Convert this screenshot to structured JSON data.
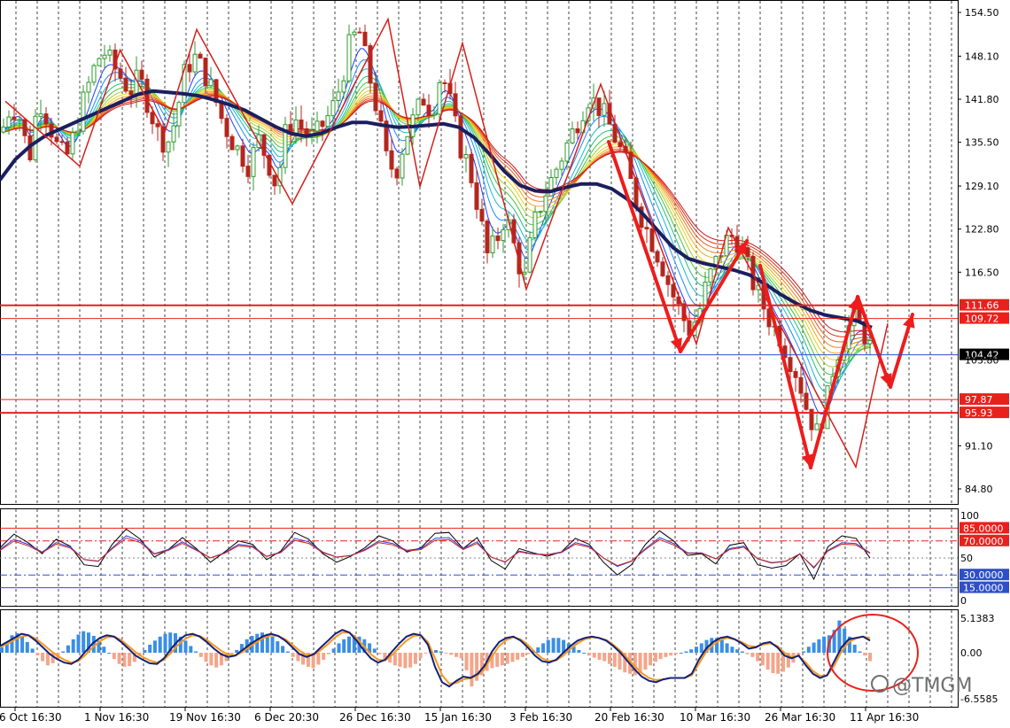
{
  "chart_data": [
    {
      "type": "candlestick",
      "yaxis": {
        "ticks": [
          154.5,
          148.1,
          141.8,
          135.5,
          129.1,
          122.8,
          116.5,
          91.1,
          84.8
        ],
        "ylim": [
          81.6,
          157.5
        ]
      },
      "x_labels": [
        "6 Oct 16:30",
        "1 Nov 16:30",
        "19 Nov 16:30",
        "6 Dec 20:30",
        "26 Dec 16:30",
        "15 Jan 16:30",
        "3 Feb 16:30",
        "20 Feb 16:30",
        "10 Mar 16:30",
        "26 Mar 16:30",
        "11 Apr 16:30"
      ],
      "close_series": [
        {
          "name": "p1",
          "values": [
            137,
            141,
            139,
            133,
            142,
            139,
            135,
            133,
            137,
            142,
            146,
            149,
            147,
            145,
            143,
            145,
            141,
            137,
            135,
            139,
            146,
            148,
            146,
            143,
            139,
            136,
            134,
            132,
            136,
            133,
            129,
            137,
            139,
            137,
            136,
            138,
            140,
            144,
            150,
            152,
            146,
            140,
            133,
            131,
            136,
            139,
            142,
            140,
            146,
            141,
            135,
            132,
            126,
            119,
            121,
            125,
            120,
            115,
            123,
            127,
            130,
            133,
            136,
            139,
            142,
            141,
            139,
            136,
            133,
            128,
            124,
            121,
            118,
            114,
            111,
            108,
            110,
            115,
            118,
            121,
            122,
            119,
            115,
            112,
            109,
            107,
            104,
            101,
            96,
            93,
            97,
            104,
            107,
            110,
            108,
            105
          ]
        }
      ],
      "ma_thick": [
        130,
        133,
        135,
        136.5,
        137.5,
        138.5,
        139.5,
        140.5,
        141.5,
        142.5,
        143,
        142.8,
        142.6,
        142.3,
        141.7,
        141.0,
        140.2,
        139.0,
        137.8,
        136.8,
        136.4,
        136.8,
        137.7,
        138.4,
        138.4,
        138.0,
        137.7,
        137.8,
        138.0,
        138.2,
        137.7,
        136.2,
        133.8,
        131.2,
        129.2,
        128.4,
        128.3,
        128.9,
        129.4,
        129.4,
        128.7,
        127.2,
        125.1,
        122.6,
        120.1,
        118.5,
        117.8,
        117.3,
        116.8,
        116.1,
        114.8,
        113.3,
        112.0,
        110.9,
        110.2,
        109.8,
        109.4,
        108.4
      ],
      "zigzag_thin": [
        [
          141.5,
          -0.5
        ],
        [
          132,
          3
        ],
        [
          149,
          4.9
        ],
        [
          137,
          7
        ],
        [
          152,
          8.5
        ],
        [
          126.5,
          13
        ],
        [
          153.5,
          17.5
        ],
        [
          129,
          19
        ],
        [
          150,
          21
        ],
        [
          114,
          24
        ],
        [
          144,
          27.5
        ],
        [
          106,
          32
        ],
        [
          123,
          33.5
        ],
        [
          88,
          39.5
        ],
        [
          109,
          41
        ]
      ],
      "forecast": [
        [
          111,
          40.5
        ],
        [
          101,
          41.7
        ],
        [
          107,
          42.5
        ]
      ],
      "hlines": [
        {
          "label": "111.66",
          "value": 111.66,
          "color": "#e8211c",
          "width": 2
        },
        {
          "label": "109.72",
          "value": 109.72,
          "color": "#e8211c",
          "width": 1
        },
        {
          "label": "104.42",
          "value": 104.42,
          "color": "#2f4fc9",
          "width": 1
        },
        {
          "label": "97.87",
          "value": 97.87,
          "color": "#e8211c",
          "width": 1
        },
        {
          "label": "95.93",
          "value": 95.93,
          "color": "#e8211c",
          "width": 2
        }
      ],
      "current_price": "104.42",
      "hidden_tick": "103.80"
    },
    {
      "type": "line",
      "yaxis": {
        "ticks": [
          "100",
          "50",
          "0"
        ],
        "ylim": [
          0,
          100
        ]
      },
      "levels": [
        {
          "label": "85.0000",
          "value": 85,
          "color": "#e8211c",
          "style": "solid"
        },
        {
          "label": "70.0000",
          "value": 70,
          "color": "#e8211c",
          "style": "dashdot"
        },
        {
          "label": "30.0000",
          "value": 30,
          "color": "#2f4fc9",
          "style": "dashdot"
        },
        {
          "label": "15.0000",
          "value": 15,
          "color": "#2f4fc9",
          "style": "solid"
        }
      ],
      "series": [
        {
          "values": [
            62,
            78,
            68,
            55,
            72,
            64,
            42,
            40,
            66,
            84,
            72,
            51,
            60,
            74,
            61,
            45,
            57,
            70,
            66,
            48,
            58,
            80,
            72,
            55,
            45,
            52,
            62,
            76,
            70,
            57,
            62,
            79,
            80,
            61,
            74,
            47,
            37,
            61,
            56,
            52,
            57,
            73,
            66,
            45,
            30,
            42,
            66,
            82,
            70,
            53,
            55,
            43,
            65,
            68,
            42,
            38,
            41,
            55,
            25,
            63,
            76,
            73,
            50
          ]
        },
        {
          "values": [
            60,
            72,
            66,
            57,
            68,
            63,
            48,
            46,
            62,
            76,
            70,
            55,
            60,
            69,
            60,
            50,
            56,
            66,
            64,
            52,
            57,
            73,
            69,
            57,
            51,
            53,
            60,
            70,
            67,
            59,
            61,
            73,
            74,
            61,
            69,
            51,
            45,
            58,
            55,
            54,
            57,
            68,
            64,
            50,
            40,
            46,
            61,
            74,
            67,
            56,
            56,
            49,
            61,
            64,
            49,
            44,
            46,
            55,
            38,
            59,
            68,
            67,
            56
          ]
        }
      ]
    },
    {
      "type": "bar",
      "yaxis": {
        "ticks": [
          "5.1383",
          "0.00",
          "-6.5585"
        ],
        "ylim": [
          -6.5585,
          5.1383
        ]
      },
      "histogram": [
        0.8,
        1.5,
        2.6,
        2.9,
        2.4,
        1.6,
        0.6,
        -0.4,
        -1.2,
        -1.8,
        -1.5,
        -0.8,
        0.2,
        1.1,
        2.0,
        2.7,
        3.2,
        3.0,
        2.5,
        1.8,
        0.9,
        0.0,
        -0.9,
        -1.6,
        -2.0,
        -1.9,
        -1.3,
        -0.5,
        0.4,
        1.2,
        1.8,
        2.4,
        2.8,
        3.0,
        2.9,
        2.4,
        1.8,
        1.0,
        0.2,
        -0.6,
        -1.3,
        -1.8,
        -2.1,
        -1.8,
        -1.2,
        -0.4,
        0.4,
        1.3,
        2.0,
        2.5,
        2.8,
        3.0,
        2.8,
        2.4,
        1.7,
        1.0,
        0.2,
        -0.6,
        -1.2,
        -1.7,
        -2.0,
        -2.2,
        -1.7,
        -1.0,
        -0.2,
        0.6,
        1.4,
        2.0,
        2.4,
        2.6,
        2.4,
        2.0,
        1.4,
        0.6,
        -0.2,
        -0.9,
        -1.4,
        -1.8,
        -2.0,
        -2.2,
        -2.1,
        -1.6,
        -0.8,
        -0.1,
        0.3,
        0.4,
        0.2,
        -0.1,
        -0.3,
        -0.6,
        -0.8,
        -2.5,
        -4.8,
        -4.0,
        -3.2,
        -2.6,
        -2.2,
        -2.0,
        -1.8,
        -1.6,
        -1.3,
        -1.0,
        -0.6,
        -0.2,
        0.3,
        0.8,
        1.4,
        1.9,
        2.2,
        2.2,
        1.9,
        1.4,
        0.9,
        0.4,
        0.0,
        -0.4,
        -0.7,
        -1.0,
        -1.2,
        -1.6,
        -2.0,
        -2.4,
        -2.8,
        -3.0,
        -3.2,
        -2.9,
        -2.4,
        -1.8,
        -1.3,
        -0.9,
        -0.6,
        -0.4,
        -0.2,
        0.0,
        0.2,
        0.5,
        0.9,
        1.4,
        1.9,
        2.2,
        2.2,
        1.9,
        1.4,
        0.9,
        0.5,
        0.2,
        -0.2,
        -0.6,
        -1.2,
        -1.8,
        -2.4,
        -2.9,
        -3.0,
        -2.7,
        -2.1,
        -1.4,
        -0.6,
        0.2,
        0.9,
        1.5,
        2.0,
        2.4,
        2.6,
        3.4,
        4.8,
        3.6,
        2.4,
        1.2,
        0.2,
        -0.4,
        -1.2
      ],
      "line_fast": [
        1.0,
        1.6,
        2.2,
        2.8,
        2.6,
        1.8,
        0.8,
        -0.2,
        -0.9,
        -1.4,
        -1.6,
        -1.0,
        0.2,
        1.4,
        2.2,
        2.6,
        2.4,
        1.6,
        0.6,
        -0.4,
        -1.0,
        -1.5,
        -1.6,
        -0.8,
        0.6,
        1.8,
        2.6,
        2.8,
        2.4,
        1.6,
        0.6,
        -0.2,
        -0.6,
        -0.4,
        0.4,
        1.2,
        1.9,
        2.5,
        2.8,
        2.5,
        1.8,
        0.8,
        -0.2,
        -0.6,
        -0.2,
        0.8,
        1.8,
        2.8,
        3.4,
        3.0,
        1.8,
        0.4,
        -0.8,
        -1.4,
        -1.0,
        0.2,
        1.4,
        2.4,
        2.8,
        2.6,
        1.2,
        -2.0,
        -4.2,
        -4.8,
        -4.0,
        -3.4,
        -3.6,
        -3.0,
        -1.8,
        0.2,
        1.6,
        2.2,
        2.4,
        1.8,
        0.8,
        -0.4,
        -1.2,
        -1.4,
        -1.0,
        0.0,
        1.0,
        1.8,
        2.2,
        2.4,
        2.2,
        1.8,
        1.0,
        0.0,
        -1.2,
        -2.4,
        -3.4,
        -4.0,
        -4.2,
        -3.8,
        -3.6,
        -3.6,
        -3.6,
        -3.0,
        -1.0,
        0.6,
        1.6,
        2.2,
        2.4,
        2.0,
        1.4,
        0.6,
        0.8,
        1.4,
        1.6,
        0.8,
        -0.4,
        -0.8,
        -0.4,
        -1.8,
        -3.0,
        -3.6,
        -3.2,
        -1.2,
        0.8,
        2.0,
        2.2,
        2.4,
        1.8
      ],
      "line_slow": [
        0.8,
        1.3,
        1.9,
        2.4,
        2.6,
        2.1,
        1.3,
        0.4,
        -0.4,
        -1.0,
        -1.4,
        -1.2,
        -0.3,
        0.8,
        1.7,
        2.3,
        2.4,
        1.9,
        1.0,
        0.1,
        -0.6,
        -1.1,
        -1.4,
        -1.0,
        0.0,
        1.2,
        2.1,
        2.6,
        2.5,
        1.9,
        1.1,
        0.3,
        -0.3,
        -0.4,
        0.1,
        0.9,
        1.6,
        2.2,
        2.6,
        2.5,
        2.0,
        1.2,
        0.3,
        -0.3,
        -0.3,
        0.4,
        1.3,
        2.3,
        3.0,
        3.0,
        2.2,
        1.0,
        -0.2,
        -1.0,
        -1.1,
        -0.3,
        0.8,
        1.8,
        2.5,
        2.6,
        1.6,
        -0.8,
        -3.2,
        -4.4,
        -4.3,
        -3.8,
        -3.6,
        -3.2,
        -2.2,
        -0.5,
        1.0,
        1.9,
        2.3,
        2.0,
        1.2,
        0.1,
        -0.8,
        -1.2,
        -1.1,
        -0.4,
        0.6,
        1.4,
        2.0,
        2.3,
        2.2,
        1.9,
        1.2,
        0.3,
        -0.8,
        -1.9,
        -2.9,
        -3.6,
        -3.9,
        -3.8,
        -3.6,
        -3.6,
        -3.6,
        -3.2,
        -1.6,
        0.1,
        1.2,
        1.9,
        2.2,
        2.0,
        1.6,
        1.0,
        0.9,
        1.2,
        1.4,
        1.0,
        0.0,
        -0.6,
        -0.5,
        -1.4,
        -2.6,
        -3.3,
        -3.2,
        -1.8,
        0.2,
        1.6,
        2.1,
        2.4,
        2.2
      ]
    }
  ],
  "watermark": "@TMGM"
}
